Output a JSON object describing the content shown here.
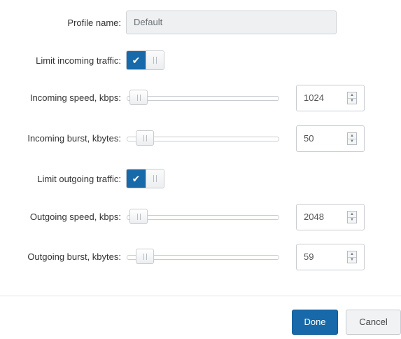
{
  "form": {
    "profile_name": {
      "label": "Profile name:",
      "value": "Default"
    },
    "limit_incoming": {
      "label": "Limit incoming traffic:",
      "checked": true,
      "check_glyph": "✔"
    },
    "incoming_speed": {
      "label": "Incoming speed, kbps:",
      "value": "1024",
      "slider_fraction": 0.02
    },
    "incoming_burst": {
      "label": "Incoming burst, kbytes:",
      "value": "50",
      "slider_fraction": 0.07
    },
    "limit_outgoing": {
      "label": "Limit outgoing traffic:",
      "checked": true,
      "check_glyph": "✔"
    },
    "outgoing_speed": {
      "label": "Outgoing speed, kbps:",
      "value": "2048",
      "slider_fraction": 0.02
    },
    "outgoing_burst": {
      "label": "Outgoing burst, kbytes:",
      "value": "59",
      "slider_fraction": 0.07
    }
  },
  "spinner_up": "▲",
  "spinner_down": "▼",
  "footer": {
    "done_label": "Done",
    "cancel_label": "Cancel"
  },
  "colors": {
    "accent": "#1769aa",
    "input_bg": "#eef0f2",
    "border": "#c8ccd1"
  }
}
